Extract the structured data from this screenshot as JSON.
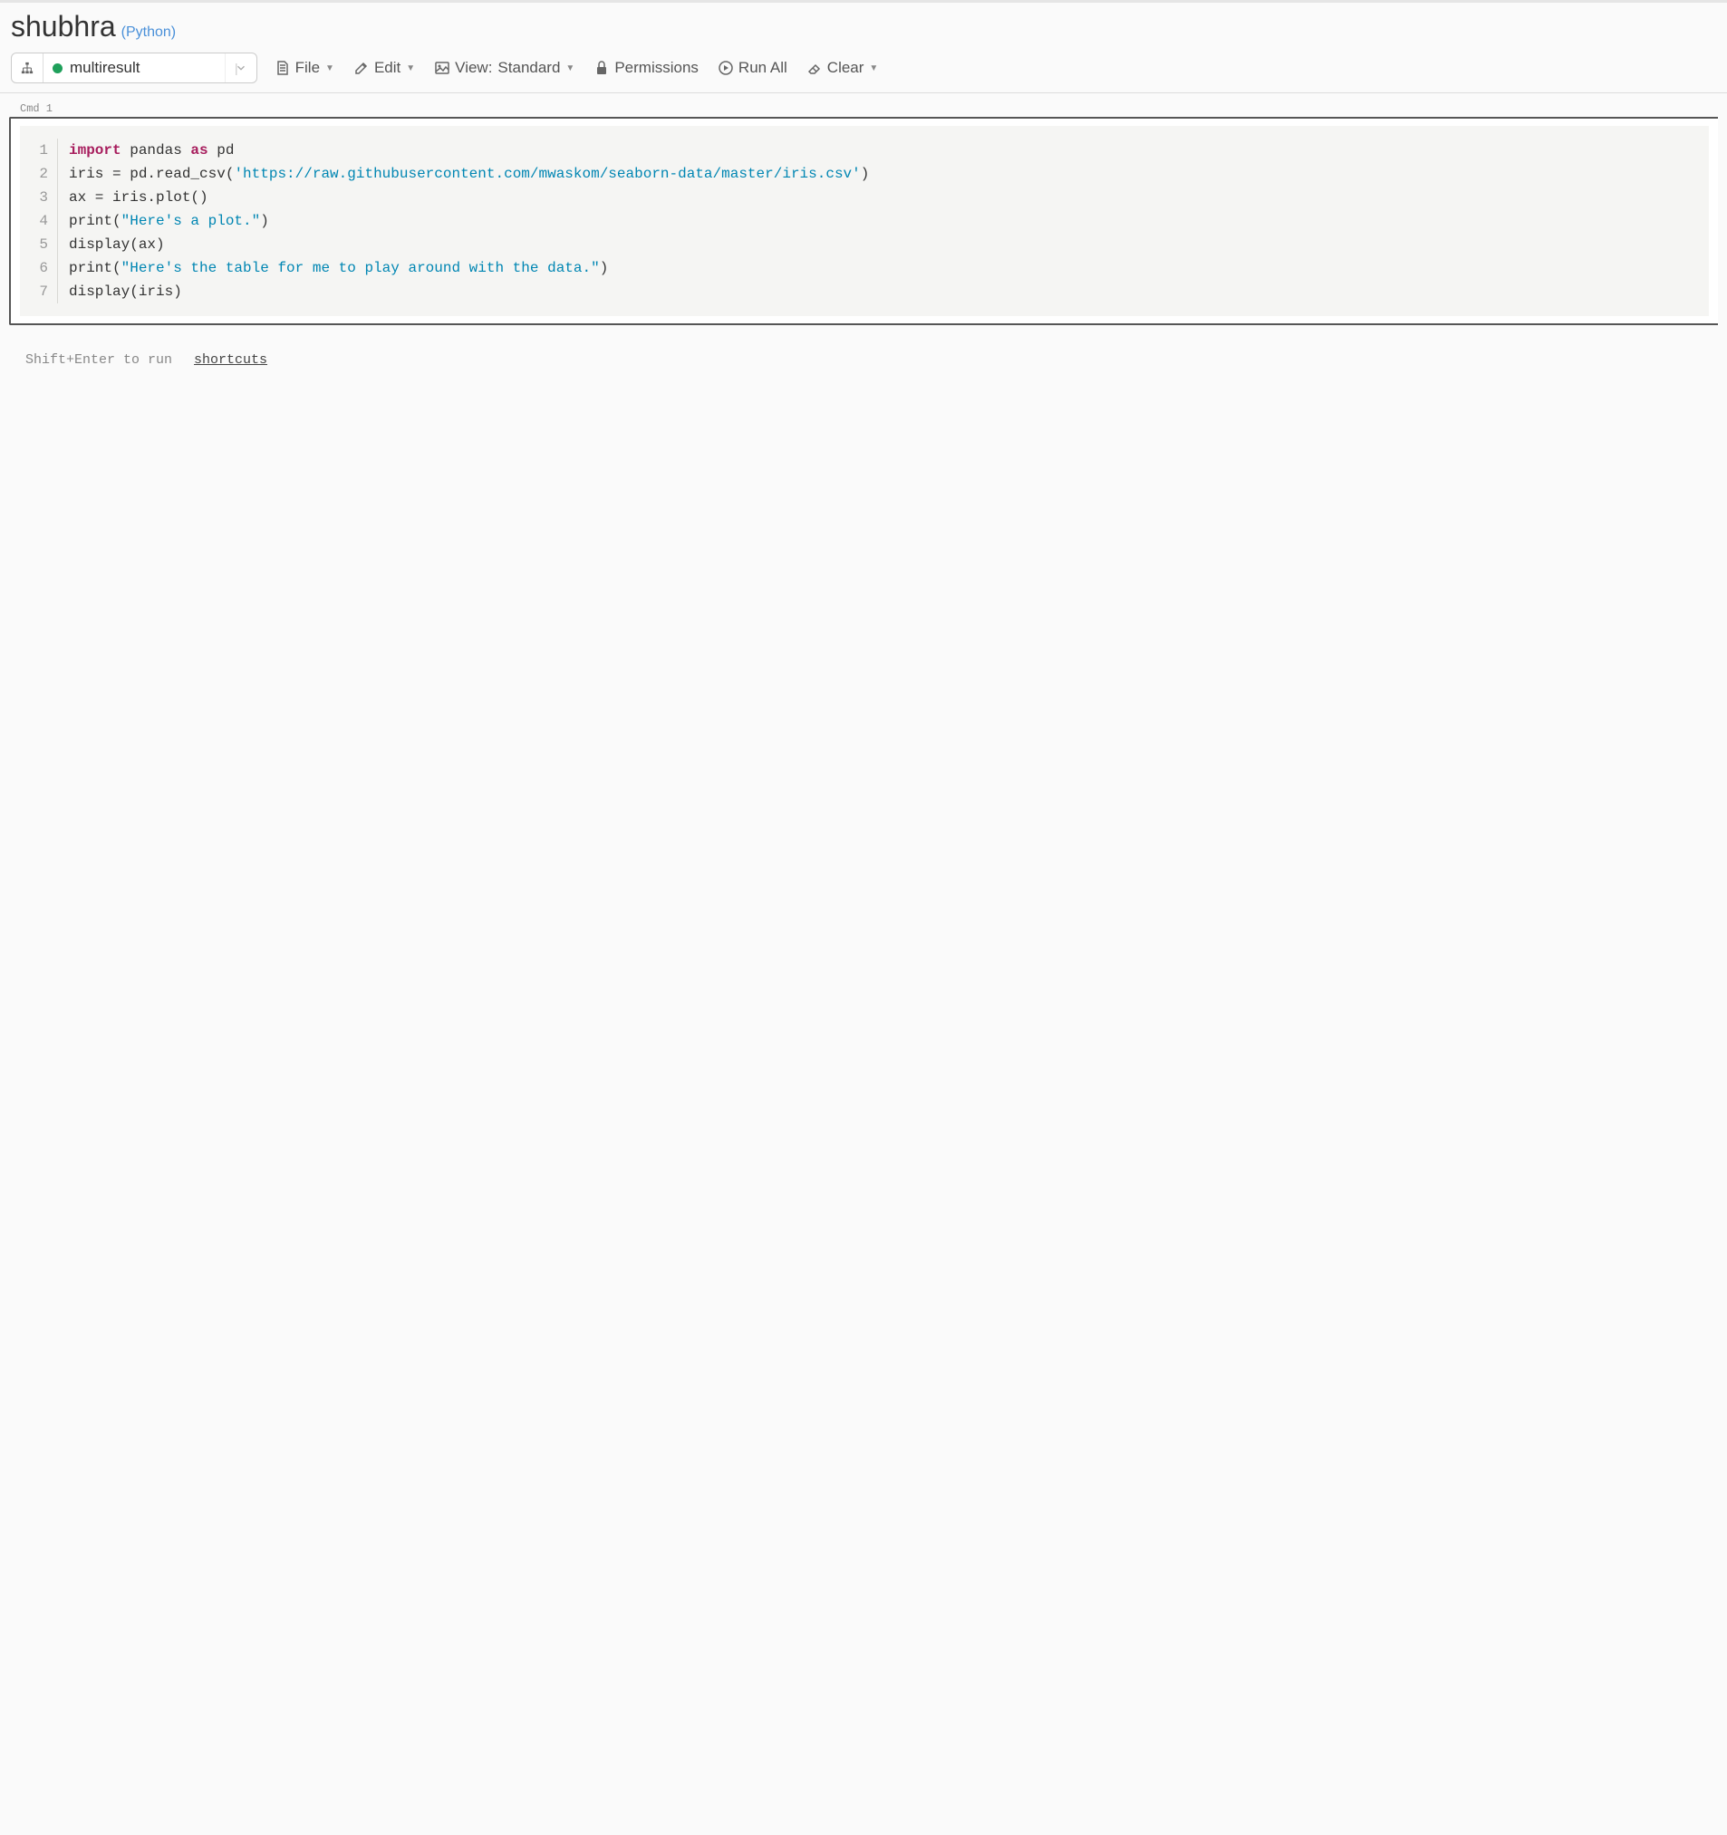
{
  "header": {
    "title": "shubhra",
    "language": "(Python)"
  },
  "cluster": {
    "name": "multiresult"
  },
  "toolbar": {
    "file": "File",
    "edit": "Edit",
    "view_prefix": "View:",
    "view_mode": "Standard",
    "permissions": "Permissions",
    "run_all": "Run All",
    "clear": "Clear"
  },
  "cell": {
    "label": "Cmd 1",
    "lines": [
      {
        "n": "1"
      },
      {
        "n": "2"
      },
      {
        "n": "3"
      },
      {
        "n": "4"
      },
      {
        "n": "5"
      },
      {
        "n": "6"
      },
      {
        "n": "7"
      }
    ],
    "code": {
      "l1_import": "import",
      "l1_pandas": " pandas ",
      "l1_as": "as",
      "l1_pd": " pd",
      "l2_pre": "iris = pd.read_csv(",
      "l2_str": "'https://raw.githubusercontent.com/mwaskom/seaborn-data/master/iris.csv'",
      "l2_post": ")",
      "l3": "ax = iris.plot()",
      "l4_pre": "print(",
      "l4_str": "\"Here's a plot.\"",
      "l4_post": ")",
      "l5": "display(ax)",
      "l6_pre": "print(",
      "l6_str": "\"Here's the table for me to play around with the data.\"",
      "l6_post": ")",
      "l7": "display(iris)"
    }
  },
  "footer": {
    "hint": "Shift+Enter to run",
    "shortcuts": "shortcuts"
  }
}
